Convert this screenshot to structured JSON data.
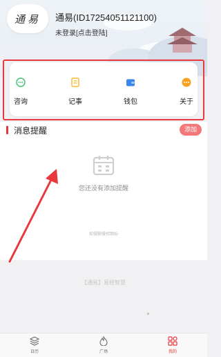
{
  "header": {
    "avatar_text": "通易",
    "username": "通易(ID17254051121100)",
    "login_prompt": "未登录[点击登陆]"
  },
  "menu": {
    "items": [
      {
        "label": "咨询",
        "icon": "chat-bubble-icon",
        "color": "#3cc06a"
      },
      {
        "label": "记事",
        "icon": "notepad-icon",
        "color": "#f5b731"
      },
      {
        "label": "钱包",
        "icon": "wallet-icon",
        "color": "#3a85ea"
      },
      {
        "label": "关于",
        "icon": "more-dots-icon",
        "color": "#f6a120"
      }
    ]
  },
  "messages": {
    "title": "消息提醒",
    "add_label": "添加",
    "empty_text": "您还没有添加提醒",
    "icon_credit": "如侵删侵权图标",
    "icon": "calendar-icon"
  },
  "footer": {
    "brand": "【通易】易经智慧"
  },
  "bottom_nav": {
    "items": [
      {
        "label": "日历",
        "icon": "layers-icon",
        "active": false
      },
      {
        "label": "广场",
        "icon": "flame-icon",
        "active": false
      },
      {
        "label": "我的",
        "icon": "grid-icon",
        "active": true
      }
    ]
  },
  "colors": {
    "accent": "#e8383d",
    "add_button": "#f2787a",
    "background": "#f1f1f3"
  }
}
